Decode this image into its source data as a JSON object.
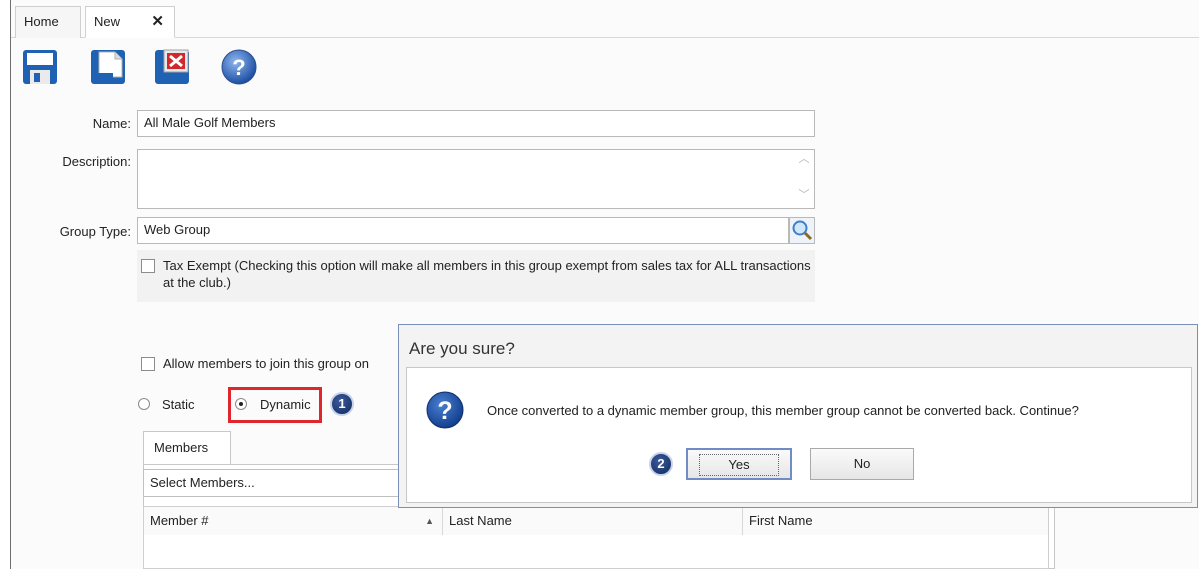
{
  "tabs": [
    {
      "label": "Home"
    },
    {
      "label": "New",
      "close": "✕"
    }
  ],
  "toolbar": {
    "save": "save-icon",
    "save_new": "save-new-icon",
    "delete": "delete-icon",
    "help": "help-icon"
  },
  "form": {
    "name_label": "Name:",
    "name_value": "All Male Golf Members",
    "description_label": "Description:",
    "description_value": "",
    "group_type_label": "Group Type:",
    "group_type_value": "Web Group",
    "tax_exempt_text": "Tax Exempt (Checking this option will make all members in this group exempt from sales tax for ALL transactions at the club.)",
    "allow_join_text": "Allow members to join this group on",
    "static_label": "Static",
    "dynamic_label": "Dynamic"
  },
  "members": {
    "tab_label": "Members",
    "select_placeholder": "Select Members...",
    "columns": [
      "Member #",
      "Last Name",
      "First Name"
    ]
  },
  "callouts": {
    "one": "1",
    "two": "2"
  },
  "dialog": {
    "title": "Are you sure?",
    "message": "Once converted to a dynamic member group, this member group cannot be converted back. Continue?",
    "yes": "Yes",
    "no": "No"
  },
  "colors": {
    "highlight": "#e0262d",
    "dialog_border": "#7a8fb8"
  }
}
